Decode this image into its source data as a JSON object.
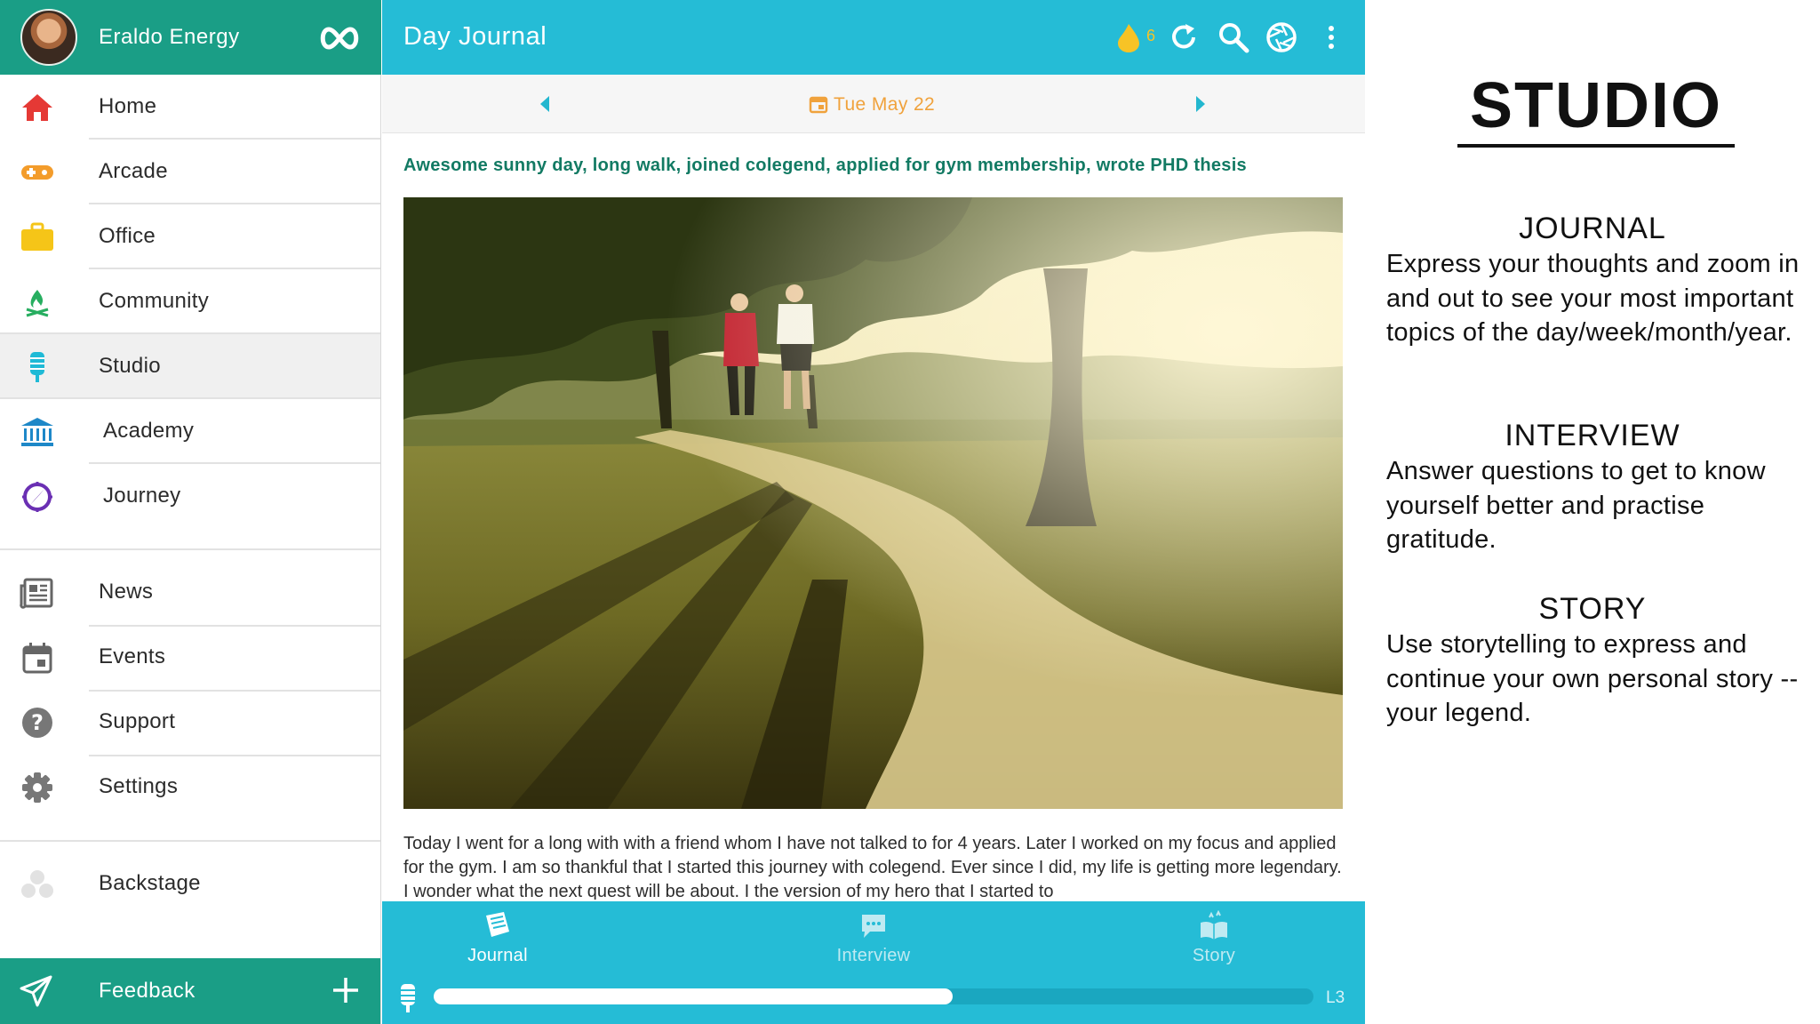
{
  "sidebar": {
    "user_name": "Eraldo Energy",
    "items": [
      {
        "label": "Home",
        "icon": "home-icon",
        "color": "#e53935"
      },
      {
        "label": "Arcade",
        "icon": "gamepad-icon",
        "color": "#f39c2b"
      },
      {
        "label": "Office",
        "icon": "briefcase-icon",
        "color": "#f5c518"
      },
      {
        "label": "Community",
        "icon": "campfire-icon",
        "color": "#27ae60"
      },
      {
        "label": "Studio",
        "icon": "microphone-icon",
        "color": "#1fbad6"
      },
      {
        "label": "Academy",
        "icon": "institution-icon",
        "color": "#1e88c8"
      },
      {
        "label": "Journey",
        "icon": "compass-icon",
        "color": "#6a2fb3"
      },
      {
        "label": "News",
        "icon": "newspaper-icon",
        "color": "#666666"
      },
      {
        "label": "Events",
        "icon": "calendar-icon",
        "color": "#666666"
      },
      {
        "label": "Support",
        "icon": "help-icon",
        "color": "#777777"
      },
      {
        "label": "Settings",
        "icon": "gear-icon",
        "color": "#777777"
      },
      {
        "label": "Backstage",
        "icon": "backstage-icon",
        "color": "#dddddd"
      }
    ],
    "active": "Studio",
    "footer_label": "Feedback"
  },
  "topbar": {
    "title": "Day Journal",
    "points": "6"
  },
  "datebar": {
    "date": "Tue May 22"
  },
  "entry": {
    "title": "Awesome sunny day, long walk, joined colegend, applied for gym membership, wrote PHD thesis",
    "body": "Today I went for a long with with a friend whom I have not talked to for 4 years. Later I worked on my focus and applied for the gym. I am so thankful that I started this journey with colegend. Ever since I did, my life is getting more legendary. I wonder what the next quest will be about. I the version of my hero that I started to"
  },
  "bottombar": {
    "tabs": [
      {
        "label": "Journal",
        "icon": "journal-icon",
        "active": true
      },
      {
        "label": "Interview",
        "icon": "chat-bubble-icon",
        "active": false
      },
      {
        "label": "Story",
        "icon": "open-book-icon",
        "active": false
      }
    ],
    "progress": 0.59,
    "level": "L3"
  },
  "panel": {
    "title": "STUDIO",
    "sections": [
      {
        "heading": "JOURNAL",
        "text": "Express your thoughts and zoom in and out to see your most important topics of the day/week/month/year."
      },
      {
        "heading": "INTERVIEW",
        "text": "Answer questions to get to know yourself better and practise gratitude."
      },
      {
        "heading": "STORY",
        "text": "Use storytelling to express and continue your own personal story -- your legend."
      }
    ]
  },
  "colors": {
    "brand_green": "#1a9e86",
    "brand_teal": "#25bcd6",
    "date_orange": "#f0a23c",
    "title_green": "#127a63"
  }
}
